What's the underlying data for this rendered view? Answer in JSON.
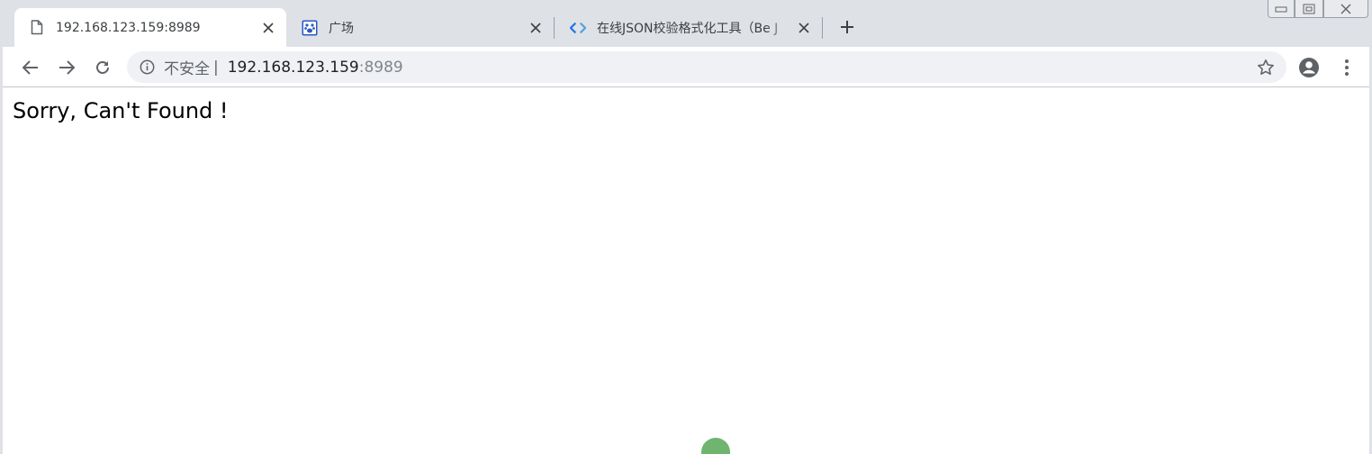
{
  "tabs": [
    {
      "title": "192.168.123.159:8989",
      "icon": "document-icon",
      "active": true
    },
    {
      "title": "广场",
      "icon": "baidu-paw-icon",
      "active": false
    },
    {
      "title": "在线JSON校验格式化工具（Be J",
      "icon": "code-brackets-icon",
      "active": false
    }
  ],
  "toolbar": {
    "back_icon": "arrow-left-icon",
    "forward_icon": "arrow-right-icon",
    "reload_icon": "reload-icon",
    "profile_icon": "account-icon",
    "menu_icon": "kebab-menu-icon"
  },
  "omnibox": {
    "security_label": "不安全",
    "divider": "|",
    "host": "192.168.123.159",
    "port": ":8989",
    "bookmark_icon": "star-outline-icon"
  },
  "page": {
    "message": "Sorry, Can't Found !"
  },
  "colors": {
    "tabstrip": "#dee1e6",
    "omnibox": "#eff1f5",
    "cursor": "#6fb46f",
    "favicon_blue": "#2b59c3"
  }
}
